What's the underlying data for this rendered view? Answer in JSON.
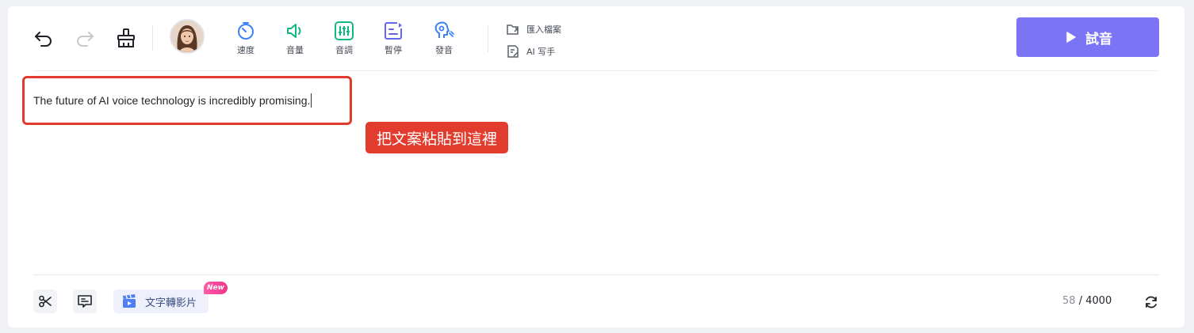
{
  "toolbar": {
    "undo_icon": "undo-icon",
    "redo_icon": "redo-icon",
    "clear_icon": "broom-icon",
    "items": [
      {
        "label": "速度",
        "icon": "speed-icon",
        "color": "#3b82f6"
      },
      {
        "label": "音量",
        "icon": "volume-icon",
        "color": "#10b981"
      },
      {
        "label": "音調",
        "icon": "pitch-icon",
        "color": "#10b981"
      },
      {
        "label": "暫停",
        "icon": "pause-icon",
        "color": "#6366f1"
      },
      {
        "label": "發音",
        "icon": "pronunciation-icon",
        "color": "#3b82f6"
      }
    ],
    "import_label": "匯入檔案",
    "ai_writer_label": "AI 写手",
    "try_button_label": "試音",
    "accent_color": "#7b74f5"
  },
  "editor": {
    "text": "The future of AI voice technology is incredibly promising."
  },
  "annotation": {
    "label": "把文案粘貼到這裡",
    "color": "#e13c2d"
  },
  "footer": {
    "text_to_video_label": "文字轉影片",
    "new_badge": "New",
    "char_count": "58",
    "char_limit": "/ 4000"
  }
}
